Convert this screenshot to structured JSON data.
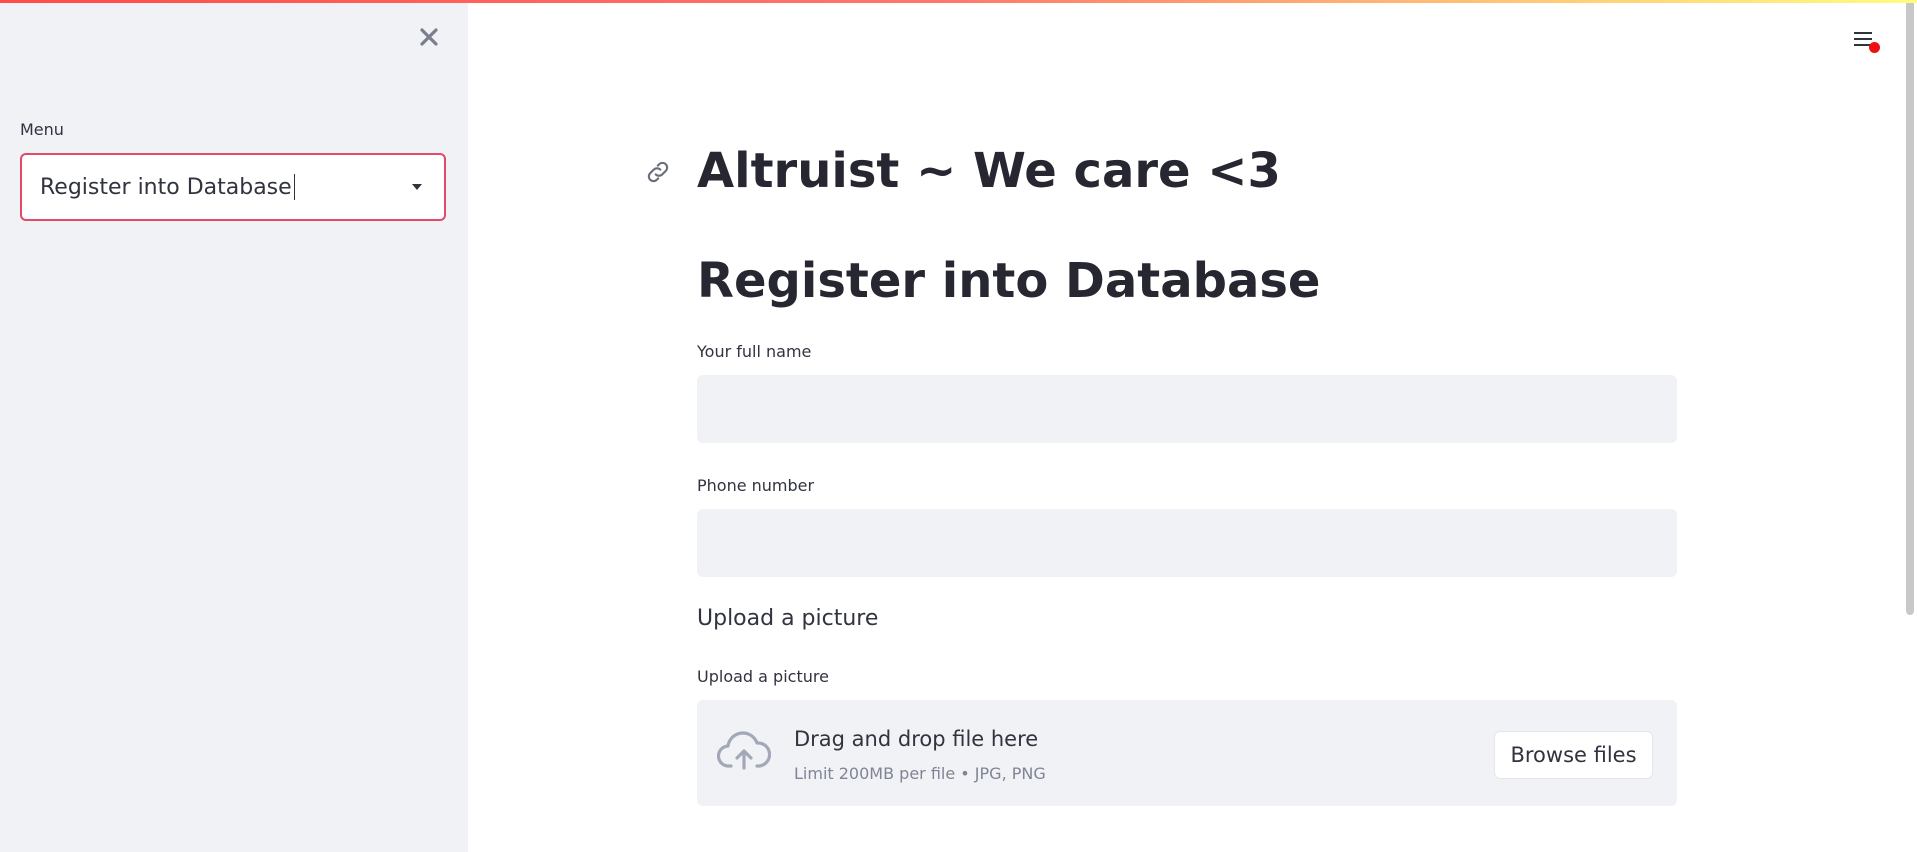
{
  "sidebar": {
    "menu_label": "Menu",
    "selected_option": "Register into Database"
  },
  "header": {
    "app_title": "Altruist ~ We care <3"
  },
  "form": {
    "section_title": "Register into Database",
    "full_name_label": "Your full name",
    "full_name_value": "",
    "phone_label": "Phone number",
    "phone_value": "",
    "upload_heading": "Upload a picture",
    "upload_label": "Upload a picture",
    "dropzone_text": "Drag and drop file here",
    "dropzone_limit": "Limit 200MB per file • JPG, PNG",
    "browse_button": "Browse files"
  },
  "icons": {
    "close": "close-icon",
    "menu": "hamburger-menu-icon",
    "link": "link-icon",
    "upload": "cloud-upload-icon",
    "dropdown": "chevron-down-icon"
  },
  "colors": {
    "accent": "#e04a6b",
    "sidebar_bg": "#f0f2f6",
    "input_bg": "#f0f2f6",
    "notification_dot": "#ee1111"
  }
}
